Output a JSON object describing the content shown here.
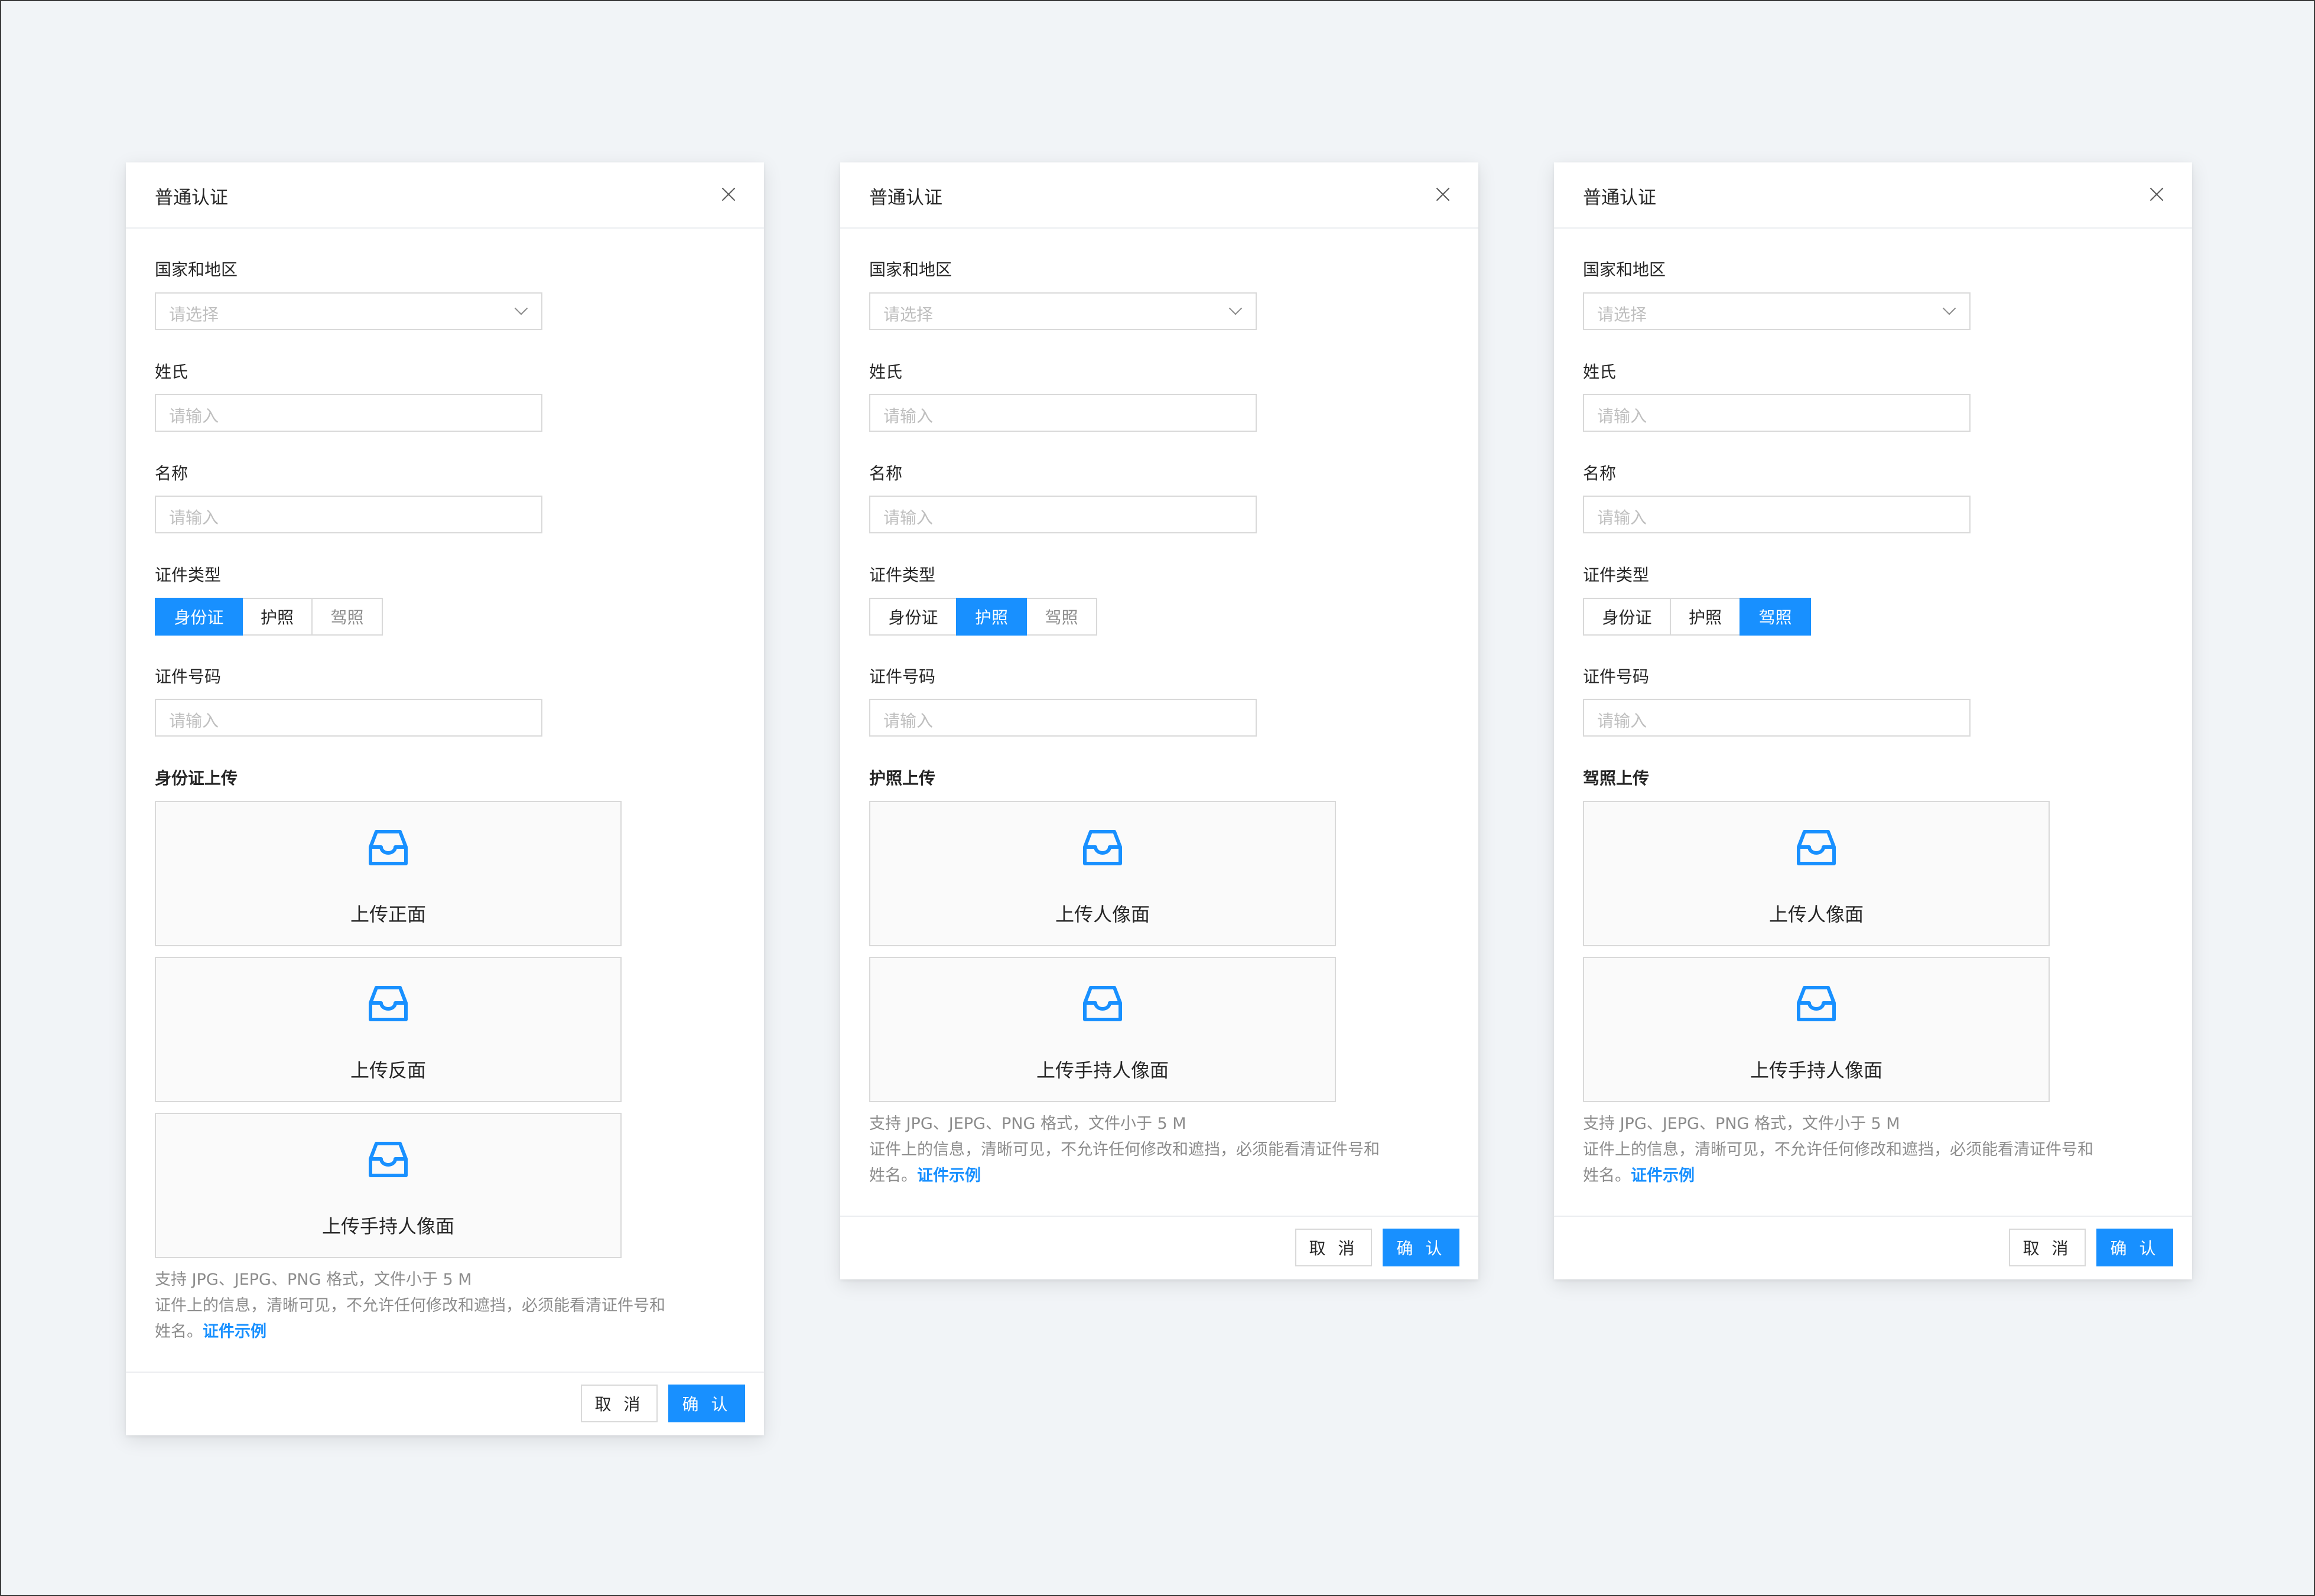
{
  "colors": {
    "accent": "#1890ff",
    "background": "#f1f4f7",
    "border": "#d9d9d9"
  },
  "modals": [
    {
      "title": "普通认证",
      "country_label": "国家和地区",
      "country_placeholder": "请选择",
      "surname_label": "姓氏",
      "surname_placeholder": "请输入",
      "name_label": "名称",
      "name_placeholder": "请输入",
      "doc_type_label": "证件类型",
      "doc_types": [
        "身份证",
        "护照",
        "驾照"
      ],
      "selected_doc_type": "身份证",
      "doc_no_label": "证件号码",
      "doc_no_placeholder": "请输入",
      "upload_title": "身份证上传",
      "upload_boxes": [
        "上传正面",
        "上传反面",
        "上传手持人像面"
      ],
      "hint_line1": "支持 JPG、JEPG、PNG 格式，文件小于 5 M",
      "hint_line2": "证件上的信息，清晰可见，不允许任何修改和遮挡，必须能看清证件号和",
      "hint_line3": "姓名。",
      "hint_link": "证件示例",
      "cancel_label": "取 消",
      "ok_label": "确 认"
    },
    {
      "title": "普通认证",
      "country_label": "国家和地区",
      "country_placeholder": "请选择",
      "surname_label": "姓氏",
      "surname_placeholder": "请输入",
      "name_label": "名称",
      "name_placeholder": "请输入",
      "doc_type_label": "证件类型",
      "doc_types": [
        "身份证",
        "护照",
        "驾照"
      ],
      "selected_doc_type": "护照",
      "doc_no_label": "证件号码",
      "doc_no_placeholder": "请输入",
      "upload_title": "护照上传",
      "upload_boxes": [
        "上传人像面",
        "上传手持人像面"
      ],
      "hint_line1": "支持 JPG、JEPG、PNG 格式，文件小于 5 M",
      "hint_line2": "证件上的信息，清晰可见，不允许任何修改和遮挡，必须能看清证件号和",
      "hint_line3": "姓名。",
      "hint_link": "证件示例",
      "cancel_label": "取 消",
      "ok_label": "确 认"
    },
    {
      "title": "普通认证",
      "country_label": "国家和地区",
      "country_placeholder": "请选择",
      "surname_label": "姓氏",
      "surname_placeholder": "请输入",
      "name_label": "名称",
      "name_placeholder": "请输入",
      "doc_type_label": "证件类型",
      "doc_types": [
        "身份证",
        "护照",
        "驾照"
      ],
      "selected_doc_type": "驾照",
      "doc_no_label": "证件号码",
      "doc_no_placeholder": "请输入",
      "upload_title": "驾照上传",
      "upload_boxes": [
        "上传人像面",
        "上传手持人像面"
      ],
      "hint_line1": "支持 JPG、JEPG、PNG 格式，文件小于 5 M",
      "hint_line2": "证件上的信息，清晰可见，不允许任何修改和遮挡，必须能看清证件号和",
      "hint_line3": "姓名。",
      "hint_link": "证件示例",
      "cancel_label": "取 消",
      "ok_label": "确 认"
    }
  ]
}
